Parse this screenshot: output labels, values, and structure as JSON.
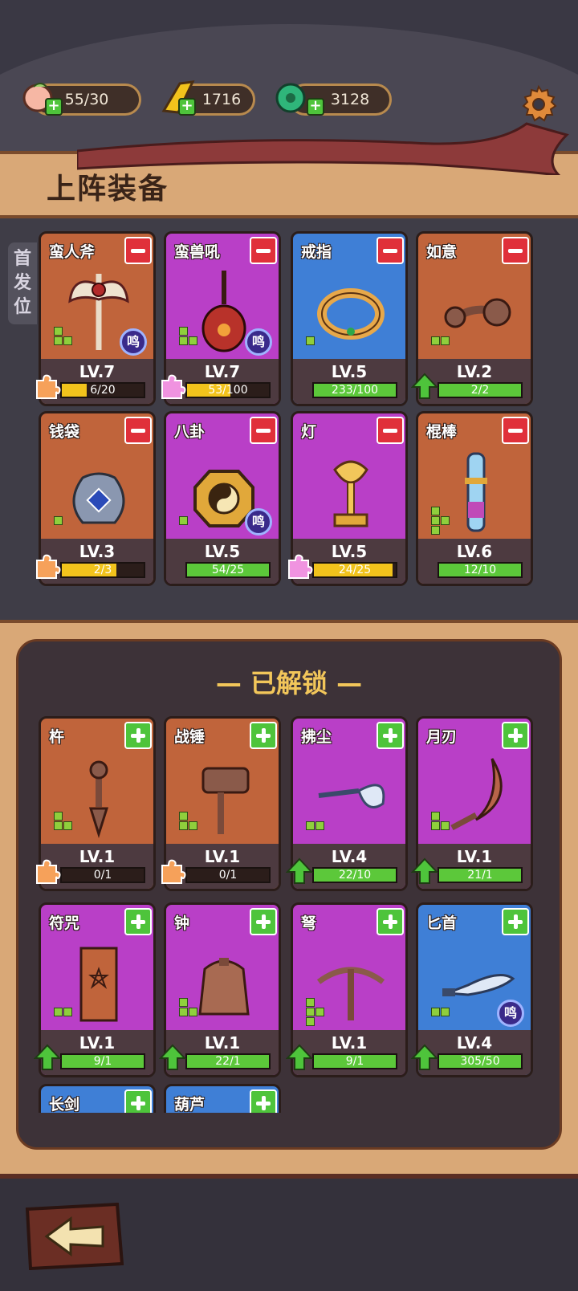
{
  "resources": [
    {
      "icon": "peach-icon",
      "value": "55/30"
    },
    {
      "icon": "gold-token-icon",
      "value": "1716"
    },
    {
      "icon": "jade-icon",
      "value": "3128"
    }
  ],
  "header": {
    "title": "上阵装备"
  },
  "side_tab": {
    "label_1": "首",
    "label_2": "发",
    "label_3": "位"
  },
  "equipped": [
    {
      "name": "蛮人斧",
      "color": "orange",
      "lv_label": "LV.",
      "level": "7",
      "progress": "6/20",
      "fill": 0.3,
      "bar_color": "#f2c31c",
      "badge": "puzzle",
      "wu": "鸣",
      "blocks": 3
    },
    {
      "name": "蛮兽吼",
      "color": "purple",
      "lv_label": "LV.",
      "level": "7",
      "progress": "53/100",
      "fill": 0.53,
      "bar_color": "#f2c31c",
      "badge": "puzzle",
      "wu": "鸣",
      "blocks": 3
    },
    {
      "name": "戒指",
      "color": "blue",
      "lv_label": "LV.",
      "level": "5",
      "progress": "233/100",
      "fill": 1.0,
      "bar_color": "#5cc83a",
      "badge": "",
      "wu": "",
      "blocks": 1
    },
    {
      "name": "如意",
      "color": "orange",
      "lv_label": "LV.",
      "level": "2",
      "progress": "2/2",
      "fill": 1.0,
      "bar_color": "#5cc83a",
      "badge": "arrow",
      "wu": "",
      "blocks": 2
    },
    {
      "name": "钱袋",
      "color": "orange",
      "lv_label": "LV.",
      "level": "3",
      "progress": "2/3",
      "fill": 0.67,
      "bar_color": "#f2c31c",
      "badge": "puzzle",
      "wu": "",
      "blocks": 1
    },
    {
      "name": "八卦",
      "color": "purple",
      "lv_label": "LV.",
      "level": "5",
      "progress": "54/25",
      "fill": 1.0,
      "bar_color": "#5cc83a",
      "badge": "",
      "wu": "鸣",
      "blocks": 1
    },
    {
      "name": "灯",
      "color": "purple",
      "lv_label": "LV.",
      "level": "5",
      "progress": "24/25",
      "fill": 0.96,
      "bar_color": "#f2c31c",
      "badge": "puzzle",
      "wu": "",
      "blocks": 0
    },
    {
      "name": "棍棒",
      "color": "orange",
      "lv_label": "LV.",
      "level": "6",
      "progress": "12/10",
      "fill": 1.0,
      "bar_color": "#5cc83a",
      "badge": "",
      "wu": "",
      "blocks": 4
    }
  ],
  "unlocked_title": "— 已解锁 —",
  "unlocked": [
    {
      "name": "杵",
      "color": "orange",
      "lv_label": "LV.",
      "level": "1",
      "progress": "0/1",
      "fill": 0.0,
      "bar_color": "#f2c31c",
      "badge": "puzzle",
      "wu": "",
      "blocks": 3
    },
    {
      "name": "战锤",
      "color": "orange",
      "lv_label": "LV.",
      "level": "1",
      "progress": "0/1",
      "fill": 0.0,
      "bar_color": "#f2c31c",
      "badge": "puzzle",
      "wu": "",
      "blocks": 3
    },
    {
      "name": "拂尘",
      "color": "purple",
      "lv_label": "LV.",
      "level": "4",
      "progress": "22/10",
      "fill": 1.0,
      "bar_color": "#5cc83a",
      "badge": "arrow",
      "wu": "",
      "blocks": 2
    },
    {
      "name": "月刃",
      "color": "purple",
      "lv_label": "LV.",
      "level": "1",
      "progress": "21/1",
      "fill": 1.0,
      "bar_color": "#5cc83a",
      "badge": "arrow",
      "wu": "",
      "blocks": 3
    },
    {
      "name": "符咒",
      "color": "purple",
      "lv_label": "LV.",
      "level": "1",
      "progress": "9/1",
      "fill": 1.0,
      "bar_color": "#5cc83a",
      "badge": "arrow",
      "wu": "",
      "blocks": 2
    },
    {
      "name": "钟",
      "color": "purple",
      "lv_label": "LV.",
      "level": "1",
      "progress": "22/1",
      "fill": 1.0,
      "bar_color": "#5cc83a",
      "badge": "arrow",
      "wu": "",
      "blocks": 3
    },
    {
      "name": "弩",
      "color": "purple",
      "lv_label": "LV.",
      "level": "1",
      "progress": "9/1",
      "fill": 1.0,
      "bar_color": "#5cc83a",
      "badge": "arrow",
      "wu": "",
      "blocks": 4
    },
    {
      "name": "匕首",
      "color": "blue",
      "lv_label": "LV.",
      "level": "4",
      "progress": "305/50",
      "fill": 1.0,
      "bar_color": "#5cc83a",
      "badge": "arrow",
      "wu": "鸣",
      "blocks": 2
    }
  ],
  "partial_cards": [
    {
      "name": "长剑",
      "color": "blue"
    },
    {
      "name": "葫芦",
      "color": "blue"
    }
  ],
  "icons": {
    "settings": "gear-icon",
    "back": "back-arrow-icon"
  }
}
